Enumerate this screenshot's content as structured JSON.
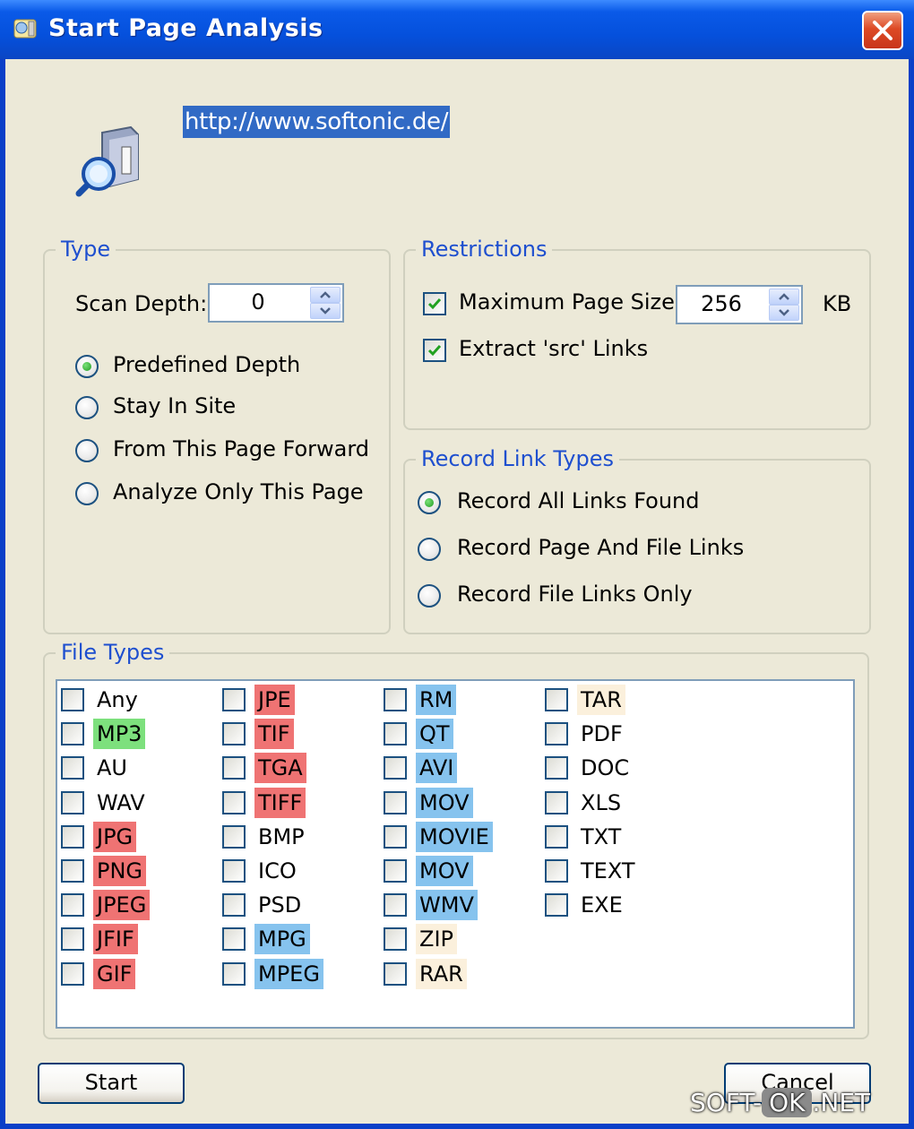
{
  "window": {
    "title": "Start Page Analysis"
  },
  "url": "http://www.softonic.de/",
  "type_group": {
    "legend": "Type",
    "scan_depth_label": "Scan Depth:",
    "scan_depth_value": "0",
    "options": [
      {
        "label": "Predefined Depth",
        "selected": true
      },
      {
        "label": "Stay In Site",
        "selected": false
      },
      {
        "label": "From This Page Forward",
        "selected": false
      },
      {
        "label": "Analyze Only This Page",
        "selected": false
      }
    ]
  },
  "restrictions": {
    "legend": "Restrictions",
    "max_page_size_label": "Maximum Page Size",
    "max_page_size_checked": true,
    "max_page_size_value": "256",
    "unit": "KB",
    "extract_src_label": "Extract 'src' Links",
    "extract_src_checked": true
  },
  "record_link_types": {
    "legend": "Record Link Types",
    "options": [
      {
        "label": "Record All Links Found",
        "selected": true
      },
      {
        "label": "Record Page And File Links",
        "selected": false
      },
      {
        "label": "Record File Links Only",
        "selected": false
      }
    ]
  },
  "file_types": {
    "legend": "File Types",
    "highlight_colors": {
      "green": "#7de07d",
      "red": "#ef7373",
      "blue": "#86c3ee",
      "beige": "#fbf0dc"
    },
    "columns": [
      [
        {
          "label": "Any",
          "hl": ""
        },
        {
          "label": "MP3",
          "hl": "green"
        },
        {
          "label": "AU",
          "hl": ""
        },
        {
          "label": "WAV",
          "hl": ""
        },
        {
          "label": "JPG",
          "hl": "red"
        },
        {
          "label": "PNG",
          "hl": "red"
        },
        {
          "label": "JPEG",
          "hl": "red"
        },
        {
          "label": "JFIF",
          "hl": "red"
        },
        {
          "label": "GIF",
          "hl": "red"
        }
      ],
      [
        {
          "label": "JPE",
          "hl": "red"
        },
        {
          "label": "TIF",
          "hl": "red"
        },
        {
          "label": "TGA",
          "hl": "red"
        },
        {
          "label": "TIFF",
          "hl": "red"
        },
        {
          "label": "BMP",
          "hl": ""
        },
        {
          "label": "ICO",
          "hl": ""
        },
        {
          "label": "PSD",
          "hl": ""
        },
        {
          "label": "MPG",
          "hl": "blue"
        },
        {
          "label": "MPEG",
          "hl": "blue"
        }
      ],
      [
        {
          "label": "RM",
          "hl": "blue"
        },
        {
          "label": "QT",
          "hl": "blue"
        },
        {
          "label": "AVI",
          "hl": "blue"
        },
        {
          "label": "MOV",
          "hl": "blue"
        },
        {
          "label": "MOVIE",
          "hl": "blue"
        },
        {
          "label": "MOV",
          "hl": "blue"
        },
        {
          "label": "WMV",
          "hl": "blue"
        },
        {
          "label": "ZIP",
          "hl": "beige"
        },
        {
          "label": "RAR",
          "hl": "beige"
        }
      ],
      [
        {
          "label": "TAR",
          "hl": "beige"
        },
        {
          "label": "PDF",
          "hl": ""
        },
        {
          "label": "DOC",
          "hl": ""
        },
        {
          "label": "XLS",
          "hl": ""
        },
        {
          "label": "TXT",
          "hl": ""
        },
        {
          "label": "TEXT",
          "hl": ""
        },
        {
          "label": "EXE",
          "hl": ""
        }
      ]
    ]
  },
  "buttons": {
    "start": "Start",
    "cancel": "Cancel"
  },
  "watermark": {
    "left": "SOFT-",
    "ok": "OK",
    "right": ".NET"
  }
}
